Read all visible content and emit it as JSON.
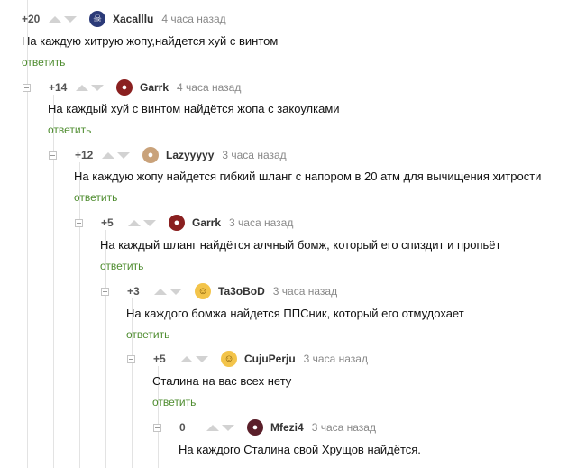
{
  "reply_label": "ответить",
  "comments": [
    {
      "rating": "+20",
      "user": "Xacalllu",
      "time": "4 часа назад",
      "text": "На каждую хитрую жопу,найдется хуй с винтом",
      "avatar_color": "#2b3a78",
      "avatar_icon": "skull-icon"
    },
    {
      "rating": "+14",
      "user": "Garrk",
      "time": "4 часа назад",
      "text": "На каждый хуй с винтом найдётся жопа с закоулками",
      "avatar_color": "#8a2020",
      "avatar_icon": "red-face-icon"
    },
    {
      "rating": "+12",
      "user": "Lazyyyyy",
      "time": "3 часа назад",
      "text": "На каждую жопу найдется гибкий шланг с напором в 20 атм  для вычищения хитрости",
      "avatar_color": "#c9a27a",
      "avatar_icon": "portrait-icon"
    },
    {
      "rating": "+5",
      "user": "Garrk",
      "time": "3 часа назад",
      "text": "На каждый шланг найдётся алчный бомж, который его спиздит и пропьёт",
      "avatar_color": "#8a2020",
      "avatar_icon": "red-face-icon"
    },
    {
      "rating": "+3",
      "user": "Ta3oBoD",
      "time": "3 часа назад",
      "text": "На каждого бомжа найдется ППСник, который его отмудохает",
      "avatar_color": "#f3c44a",
      "avatar_icon": "emoji-icon"
    },
    {
      "rating": "+5",
      "user": "CujuPerju",
      "time": "3 часа назад",
      "text": "Сталина на вас всех нету",
      "avatar_color": "#f3c44a",
      "avatar_icon": "emoji-icon"
    },
    {
      "rating": "0",
      "user": "Mfezi4",
      "time": "3 часа назад",
      "text": "На каждого Сталина свой Хрущов найдётся.",
      "avatar_color": "#5a1f2a",
      "avatar_icon": "dark-portrait-icon"
    }
  ]
}
